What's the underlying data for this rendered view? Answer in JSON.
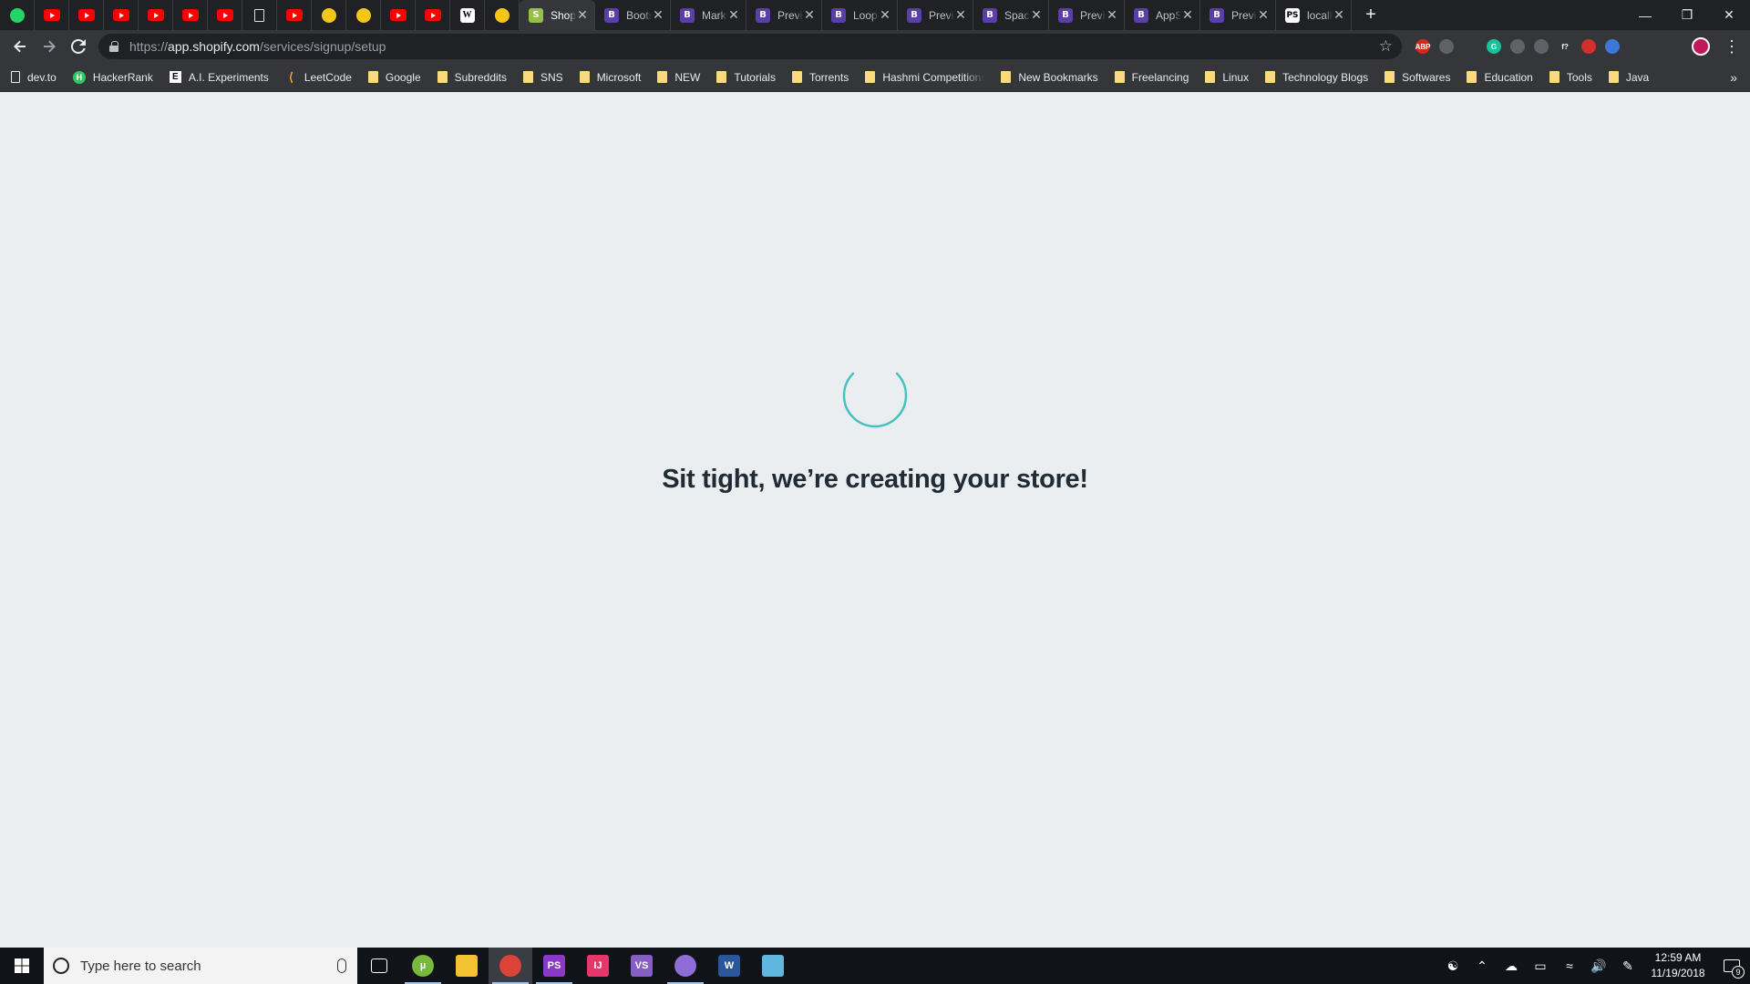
{
  "browser": {
    "tabs": [
      {
        "label": "Shopify",
        "icon": "shopify-icon",
        "active": true
      },
      {
        "label": "Bootstrap",
        "icon": "bootstrap-icon",
        "active": false
      },
      {
        "label": "Market",
        "icon": "bootstrap-icon",
        "active": false
      },
      {
        "label": "Preview",
        "icon": "bootstrap-icon",
        "active": false
      },
      {
        "label": "Looper",
        "icon": "bootstrap-icon",
        "active": false
      },
      {
        "label": "Preview",
        "icon": "bootstrap-icon",
        "active": false
      },
      {
        "label": "Space",
        "icon": "bootstrap-icon",
        "active": false
      },
      {
        "label": "Preview",
        "icon": "bootstrap-icon",
        "active": false
      },
      {
        "label": "AppStack",
        "icon": "bootstrap-icon",
        "active": false
      },
      {
        "label": "Preview",
        "icon": "bootstrap-icon",
        "active": false
      },
      {
        "label": "localhost",
        "icon": "ps-icon",
        "active": false
      }
    ],
    "pinned_tabs": [
      "whatsapp-icon",
      "youtube-icon",
      "youtube-icon",
      "youtube-icon",
      "youtube-icon",
      "youtube-icon",
      "youtube-icon",
      "document-icon",
      "youtube-icon",
      "snapchat-icon",
      "snapchat-icon",
      "youtube-icon",
      "youtube-icon",
      "wiki-icon",
      "snapchat-icon"
    ],
    "address": {
      "scheme": "https://",
      "host": "app.shopify.com",
      "path": "/services/signup/setup"
    },
    "extensions": [
      {
        "name": "adblock-plus-icon",
        "text": "ABP",
        "color": "#d9261c"
      },
      {
        "name": "dark-mode-icon",
        "text": "",
        "color": "#5f6368"
      },
      {
        "name": "extension-x-icon",
        "text": "",
        "color": "#35363a"
      },
      {
        "name": "grammarly-icon",
        "text": "G",
        "color": "#15c39a"
      },
      {
        "name": "extension-icon",
        "text": "",
        "color": "#5f6368"
      },
      {
        "name": "settings-extension-icon",
        "text": "",
        "color": "#5f6368"
      },
      {
        "name": "font-finder-icon",
        "text": "f?",
        "color": "#35363a"
      },
      {
        "name": "favorite-heart-icon",
        "text": "",
        "color": "#d32f2f"
      },
      {
        "name": "extension-globe-icon",
        "text": "",
        "color": "#3c78d8"
      }
    ]
  },
  "bookmarks": [
    {
      "label": "dev.to",
      "type": "page"
    },
    {
      "label": "HackerRank",
      "type": "hr"
    },
    {
      "label": "A.I. Experiments",
      "type": "ai"
    },
    {
      "label": "LeetCode",
      "type": "lc"
    },
    {
      "label": "Google",
      "type": "folder"
    },
    {
      "label": "Subreddits",
      "type": "folder"
    },
    {
      "label": "SNS",
      "type": "folder"
    },
    {
      "label": "Microsoft",
      "type": "folder"
    },
    {
      "label": "NEW",
      "type": "folder"
    },
    {
      "label": "Tutorials",
      "type": "folder"
    },
    {
      "label": "Torrents",
      "type": "folder"
    },
    {
      "label": "Hashmi Competitions",
      "type": "folder"
    },
    {
      "label": "New Bookmarks",
      "type": "folder"
    },
    {
      "label": "Freelancing",
      "type": "folder"
    },
    {
      "label": "Linux",
      "type": "folder"
    },
    {
      "label": "Technology Blogs",
      "type": "folder"
    },
    {
      "label": "Softwares",
      "type": "folder"
    },
    {
      "label": "Education",
      "type": "folder"
    },
    {
      "label": "Tools",
      "type": "folder"
    },
    {
      "label": "Java",
      "type": "folder"
    }
  ],
  "page": {
    "message": "Sit tight, we’re creating your store!",
    "spinner_color": "#47c1bf"
  },
  "taskbar": {
    "search_placeholder": "Type here to search",
    "apps": [
      {
        "name": "task-view-icon",
        "color": "transparent",
        "text": "",
        "running": false
      },
      {
        "name": "utorrent-icon",
        "color": "#78b83d",
        "text": "µ",
        "running": true
      },
      {
        "name": "file-explorer-icon",
        "color": "#f2c230",
        "text": "",
        "running": false
      },
      {
        "name": "chrome-icon",
        "color": "#db4437",
        "text": "",
        "running": true,
        "focused": true
      },
      {
        "name": "phpstorm-icon",
        "color": "#8a38c9",
        "text": "PS",
        "running": true
      },
      {
        "name": "intellij-icon",
        "color": "#e8356a",
        "text": "IJ",
        "running": false
      },
      {
        "name": "visual-studio-icon",
        "color": "#865fc5",
        "text": "VS",
        "running": false
      },
      {
        "name": "github-desktop-icon",
        "color": "#8f6dd6",
        "text": "",
        "running": true
      },
      {
        "name": "word-icon",
        "color": "#2b579a",
        "text": "W",
        "running": false
      },
      {
        "name": "notepad-icon",
        "color": "#5fb7e0",
        "text": "",
        "running": false
      }
    ],
    "clock": {
      "time": "12:59 AM",
      "date": "11/19/2018"
    },
    "notification_count": "9"
  }
}
